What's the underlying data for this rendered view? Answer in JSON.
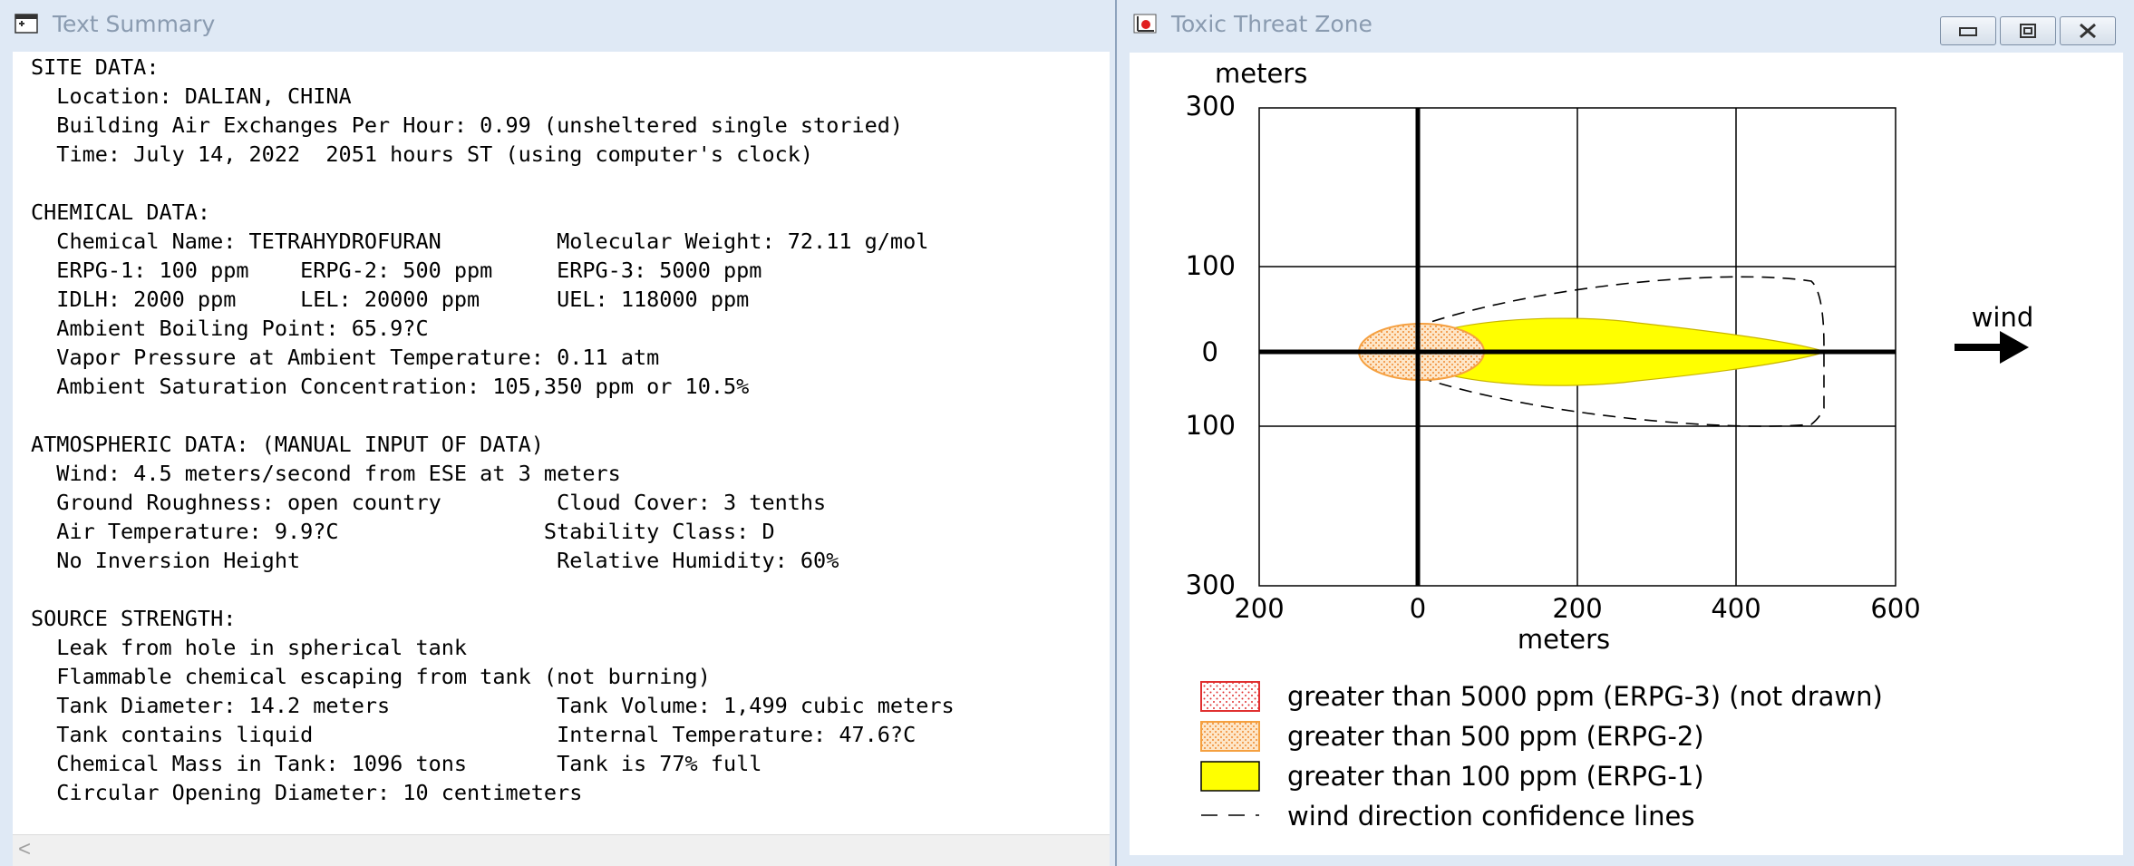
{
  "text_window": {
    "title": "Text Summary",
    "lines": [
      "SITE DATA:",
      "  Location: DALIAN, CHINA",
      "  Building Air Exchanges Per Hour: 0.99 (unsheltered single storied)",
      "  Time: July 14, 2022  2051 hours ST (using computer's clock)",
      "",
      "CHEMICAL DATA:",
      "  Chemical Name: TETRAHYDROFURAN         Molecular Weight: 72.11 g/mol",
      "  ERPG-1: 100 ppm    ERPG-2: 500 ppm     ERPG-3: 5000 ppm",
      "  IDLH: 2000 ppm     LEL: 20000 ppm      UEL: 118000 ppm",
      "  Ambient Boiling Point: 65.9?C",
      "  Vapor Pressure at Ambient Temperature: 0.11 atm",
      "  Ambient Saturation Concentration: 105,350 ppm or 10.5%",
      "",
      "ATMOSPHERIC DATA: (MANUAL INPUT OF DATA)",
      "  Wind: 4.5 meters/second from ESE at 3 meters",
      "  Ground Roughness: open country         Cloud Cover: 3 tenths",
      "  Air Temperature: 9.9?C                Stability Class: D",
      "  No Inversion Height                    Relative Humidity: 60%",
      "",
      "SOURCE STRENGTH:",
      "  Leak from hole in spherical tank",
      "  Flammable chemical escaping from tank (not burning)",
      "  Tank Diameter: 14.2 meters             Tank Volume: 1,499 cubic meters",
      "  Tank contains liquid                   Internal Temperature: 47.6?C",
      "  Chemical Mass in Tank: 1096 tons       Tank is 77% full",
      "  Circular Opening Diameter: 10 centimeters"
    ],
    "scroll_left_glyph": "<"
  },
  "zone_window": {
    "title": "Toxic Threat Zone",
    "buttons": [
      "minimize",
      "restore",
      "close"
    ],
    "y_unit": "meters",
    "x_unit": "meters",
    "y_ticks": [
      "300",
      "100",
      "0",
      "100",
      "300"
    ],
    "x_ticks": [
      "200",
      "0",
      "200",
      "400",
      "600"
    ],
    "wind_label": "wind",
    "legend": [
      {
        "label": "greater than 5000 ppm (ERPG-3) (not drawn)",
        "swatch": "red-dots"
      },
      {
        "label": "greater than 500 ppm (ERPG-2)",
        "swatch": "orange-dots"
      },
      {
        "label": "greater than 100 ppm (ERPG-1)",
        "swatch": "yellow"
      },
      {
        "label": "wind direction confidence lines",
        "swatch": "dashed"
      }
    ],
    "colors": {
      "erpg3": "#e03030",
      "erpg2": "#f5a040",
      "erpg2_fill": "#fde6c8",
      "erpg1": "#ffff00",
      "plume_outline": "#c8b400"
    }
  }
}
